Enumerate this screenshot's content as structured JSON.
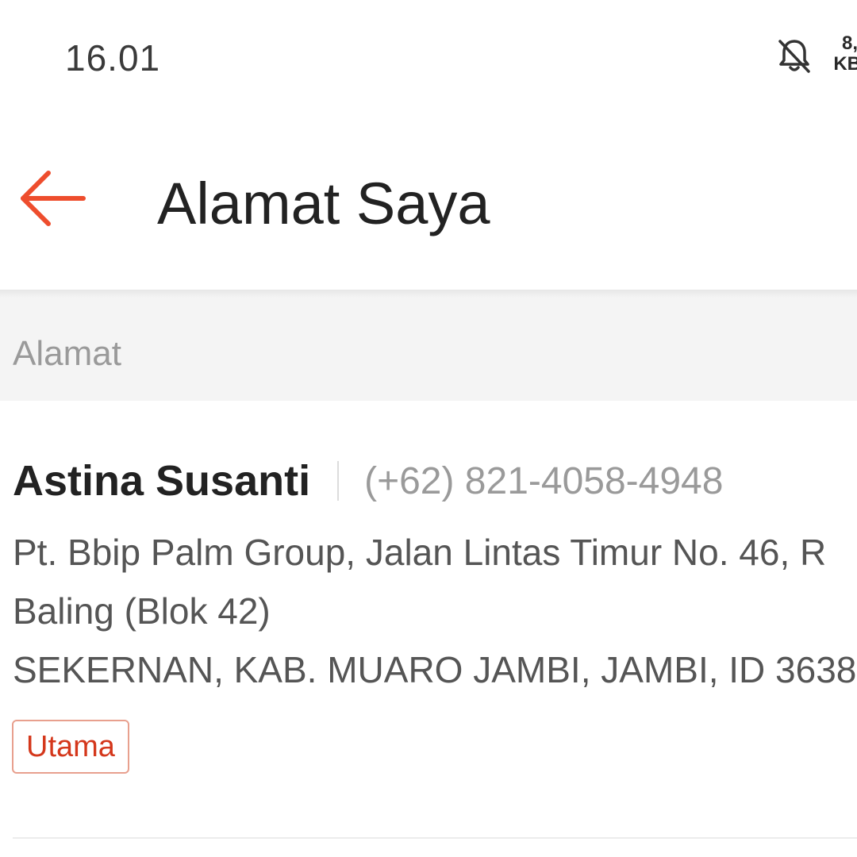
{
  "status_bar": {
    "time": "16.01",
    "net_speed_value": "8,",
    "net_speed_unit": "KB/"
  },
  "header": {
    "title": "Alamat Saya",
    "back_icon": "arrow-left-icon",
    "accent_color": "#ee4d2d"
  },
  "section": {
    "title": "Alamat"
  },
  "address": {
    "name": "Astina Susanti",
    "phone": "(+62) 821-4058-4948",
    "line1": "Pt. Bbip Palm Group, Jalan Lintas Timur No. 46, R",
    "line2": "Baling (Blok 42)",
    "line3": "SEKERNAN, KAB. MUARO JAMBI, JAMBI, ID 3638",
    "badge": "Utama",
    "badge_color": "#d4371b"
  }
}
